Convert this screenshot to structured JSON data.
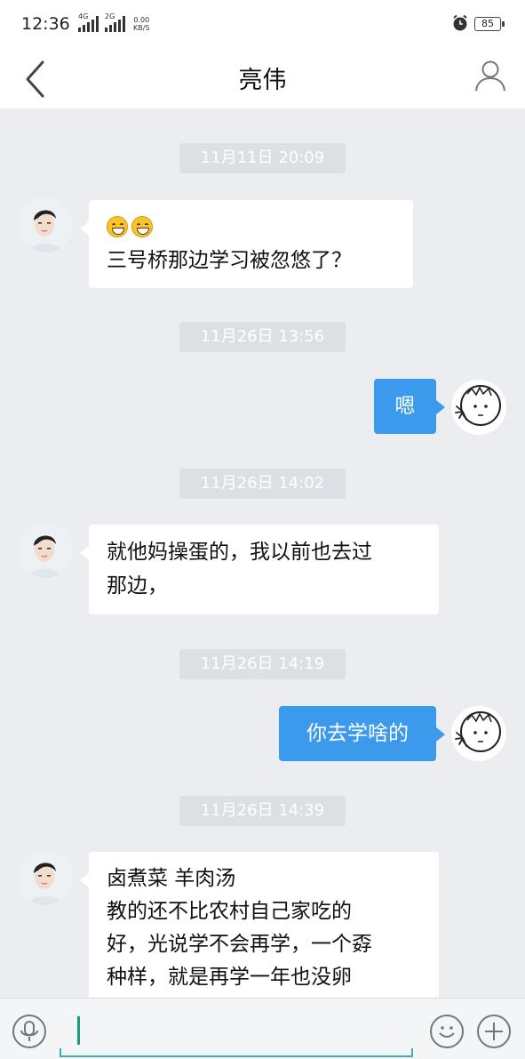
{
  "status_bar": {
    "time": "12:36",
    "sim1_label": "4G",
    "sim2_label": "2G",
    "net_speed_value": "0.00",
    "net_speed_unit": "KB/S",
    "battery": "85"
  },
  "header": {
    "title": "亮伟"
  },
  "messages": [
    {
      "type": "timestamp",
      "text": "11月11日 20:09"
    },
    {
      "type": "received",
      "emoji_count": 2,
      "lines": [
        "三号桥那边学习被忽悠了？"
      ]
    },
    {
      "type": "timestamp",
      "text": "11月26日 13:56"
    },
    {
      "type": "sent",
      "lines": [
        "嗯"
      ]
    },
    {
      "type": "timestamp",
      "text": "11月26日 14:02"
    },
    {
      "type": "received",
      "lines": [
        "就他妈操蛋的，我以前也去过",
        "那边，"
      ]
    },
    {
      "type": "timestamp",
      "text": "11月26日 14:19"
    },
    {
      "type": "sent",
      "lines": [
        "你去学啥的"
      ]
    },
    {
      "type": "timestamp",
      "text": "11月26日 14:39"
    },
    {
      "type": "received",
      "lines": [
        "卤煮菜 羊肉汤",
        "教的还不比农村自己家吃的",
        "好，光说学不会再学，一个孬",
        "种样，就是再学一年也没卵"
      ]
    }
  ],
  "input_bar": {
    "value": "",
    "icons": [
      "microphone-icon",
      "smiley-icon",
      "plus-icon"
    ]
  },
  "colors": {
    "sent_bubble": "#3c9aec",
    "chat_background": "#ebedf0",
    "timestamp_pill": "#dcdfe4"
  }
}
